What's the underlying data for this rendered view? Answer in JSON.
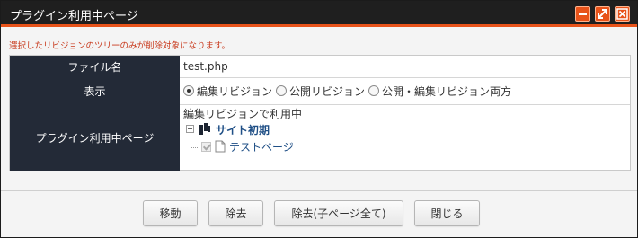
{
  "window": {
    "title": "プラグイン利用中ページ",
    "accent_color": "#e8531a",
    "controls": [
      "minimize-icon",
      "maximize-icon",
      "close-icon"
    ]
  },
  "notice": "選択したリビジョンのツリーのみが削除対象になります。",
  "form": {
    "file_label": "ファイル名",
    "file_value": "test.php",
    "display_label": "表示",
    "display_options": [
      {
        "label": "編集リビジョン",
        "selected": true
      },
      {
        "label": "公開リビジョン",
        "selected": false
      },
      {
        "label": "公開・編集リビジョン両方",
        "selected": false
      }
    ],
    "pages_label": "プラグイン利用中ページ",
    "usage_text": "編集リビジョンで利用中",
    "tree": {
      "root": {
        "label": "サイト初期",
        "icon": "site-root-icon",
        "expanded": true
      },
      "children": [
        {
          "label": "テストページ",
          "icon": "page-icon",
          "checked": true,
          "disabled": true
        }
      ]
    }
  },
  "buttons": {
    "move": "移動",
    "remove": "除去",
    "remove_all": "除去(子ページ全て)",
    "close": "閉じる"
  }
}
